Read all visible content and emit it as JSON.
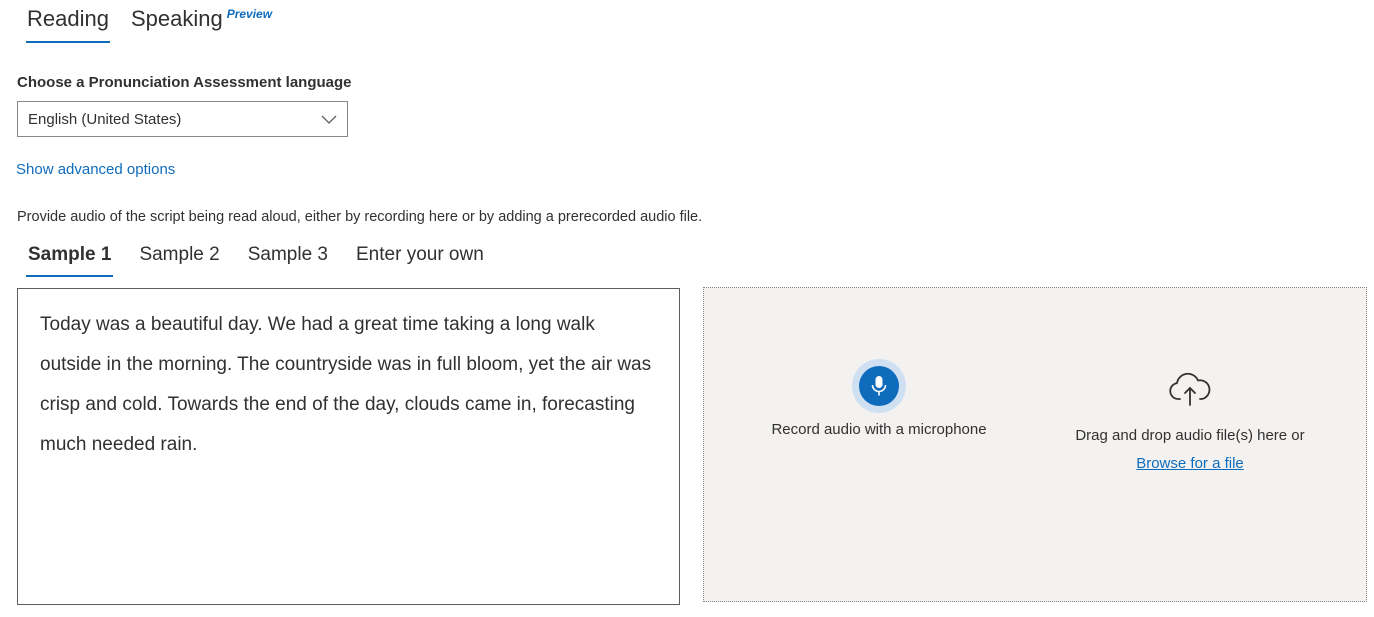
{
  "top_tabs": [
    {
      "label": "Reading",
      "active": true
    },
    {
      "label": "Speaking",
      "badge": "Preview",
      "active": false
    }
  ],
  "language": {
    "label": "Choose a Pronunciation Assessment language",
    "selected": "English (United States)"
  },
  "advanced_link": "Show advanced options",
  "instructions": "Provide audio of the script being read aloud, either by recording here or by adding a prerecorded audio file.",
  "sample_tabs": [
    {
      "label": "Sample 1",
      "active": true
    },
    {
      "label": "Sample 2",
      "active": false
    },
    {
      "label": "Sample 3",
      "active": false
    },
    {
      "label": "Enter your own",
      "active": false
    }
  ],
  "script_text": "Today was a beautiful day. We had a great time taking a long walk outside in the morning. The countryside was in full bloom, yet the air was crisp and cold. Towards the end of the day, clouds came in, forecasting much needed rain.",
  "audio": {
    "record_label": "Record audio with a microphone",
    "record_icon": "microphone-icon",
    "upload_icon": "cloud-upload-icon",
    "drag_label": "Drag and drop audio file(s) here or",
    "browse_label": "Browse for a file"
  },
  "colors": {
    "accent": "#0f6cbd",
    "drop_zone_bg": "#f3f2f1",
    "mic_halo": "#cfe0f3"
  }
}
